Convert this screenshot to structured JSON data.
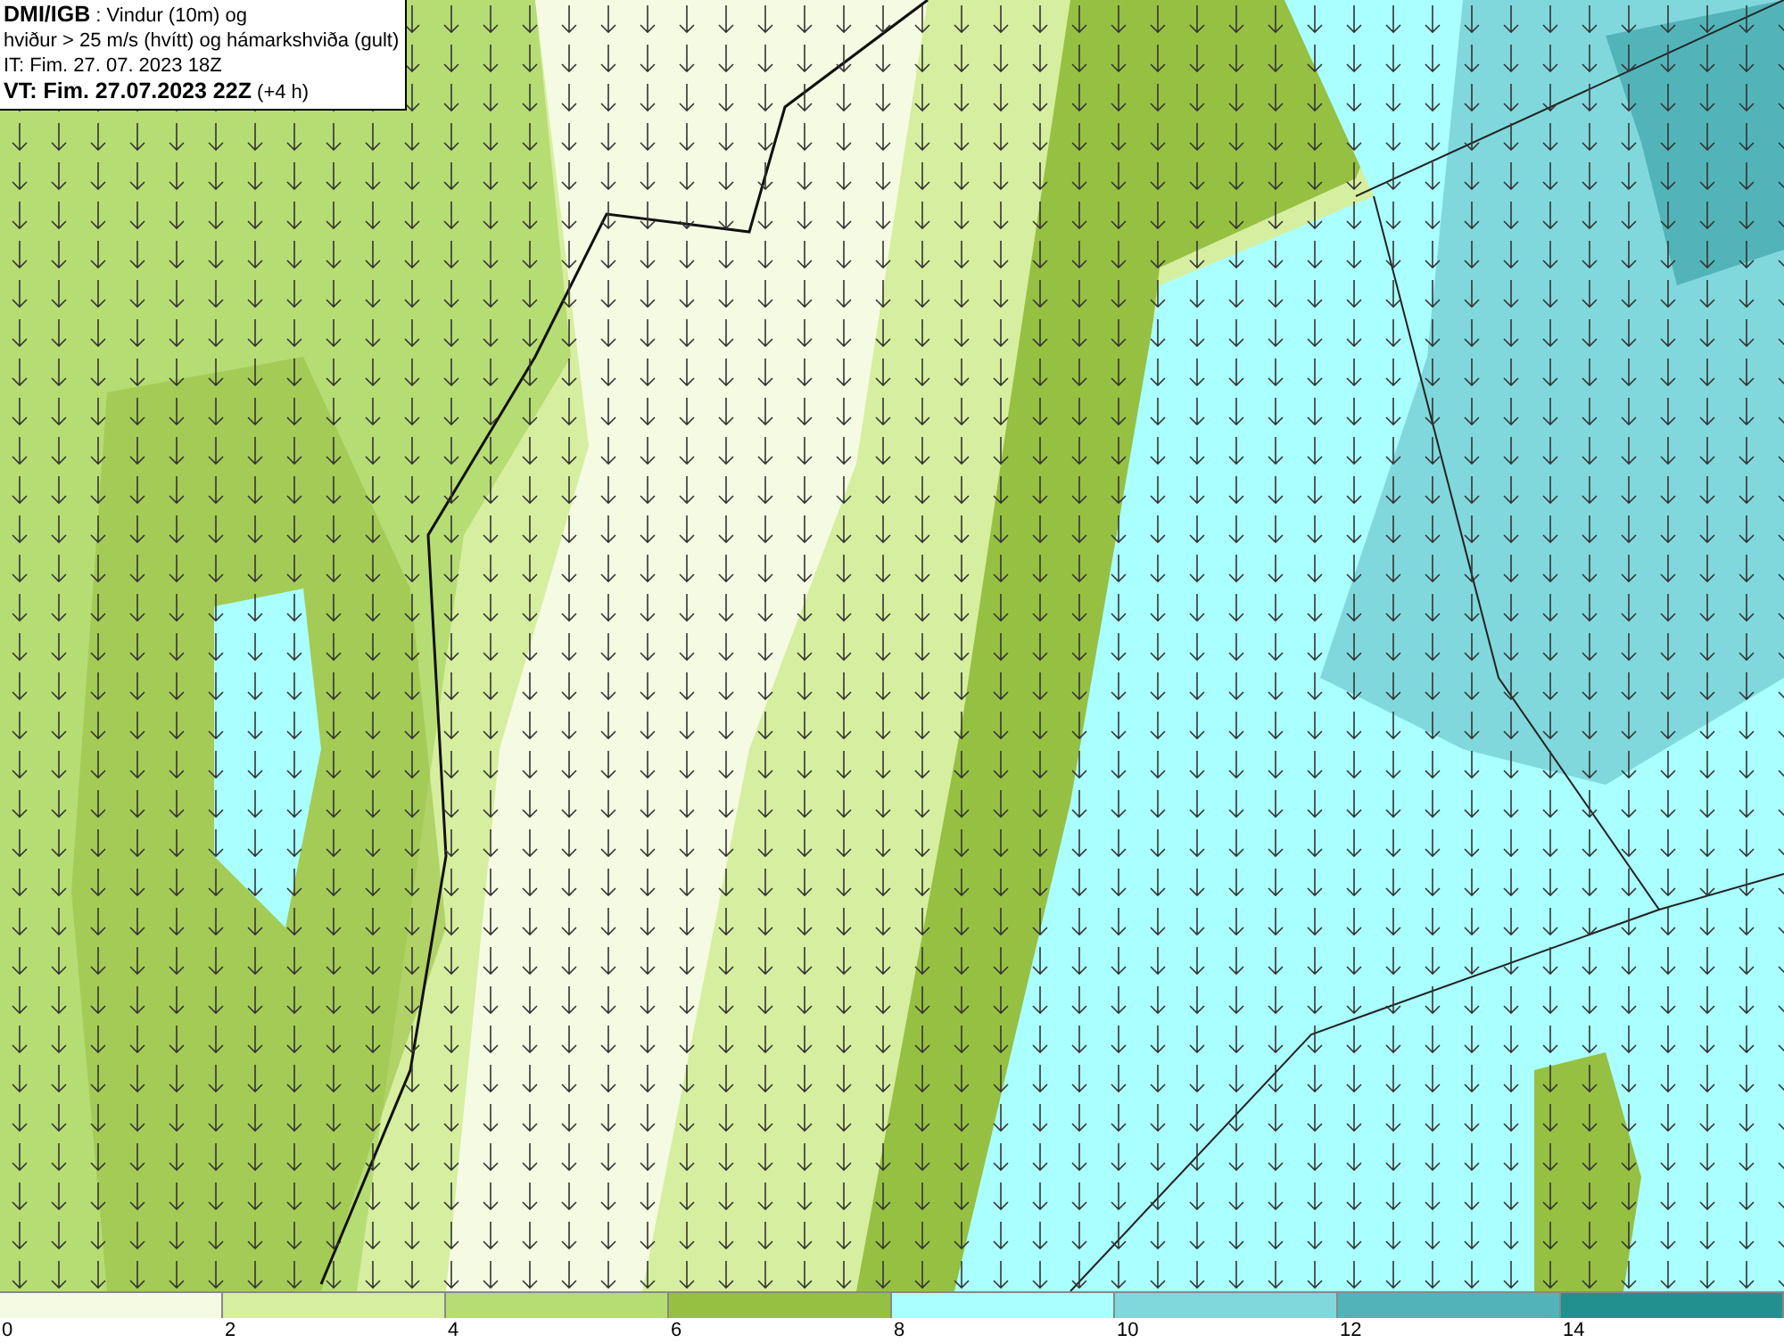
{
  "title_box": {
    "lines": [
      "**DMI/IGB** : Vindur (10m) og",
      "hviður > 25 m/s (hvítt) og hámarkshviða (gult)",
      "IT: Fim. 27. 07. 2023 18Z",
      "**VT: Fim. 27.07.2023 22Z** (+4 h)"
    ]
  },
  "legend": [
    {
      "color": "#f4fbe2",
      "label": "0"
    },
    {
      "color": "#d6ee9f",
      "label": "2"
    },
    {
      "color": "#b6dc74",
      "label": "4"
    },
    {
      "color": "#96c042",
      "label": "6"
    },
    {
      "color": "#aaffff",
      "label": "8"
    },
    {
      "color": "#80d8dc",
      "label": "10"
    },
    {
      "color": "#52b4b8",
      "label": "12"
    },
    {
      "color": "#239090",
      "label": "14"
    }
  ]
}
